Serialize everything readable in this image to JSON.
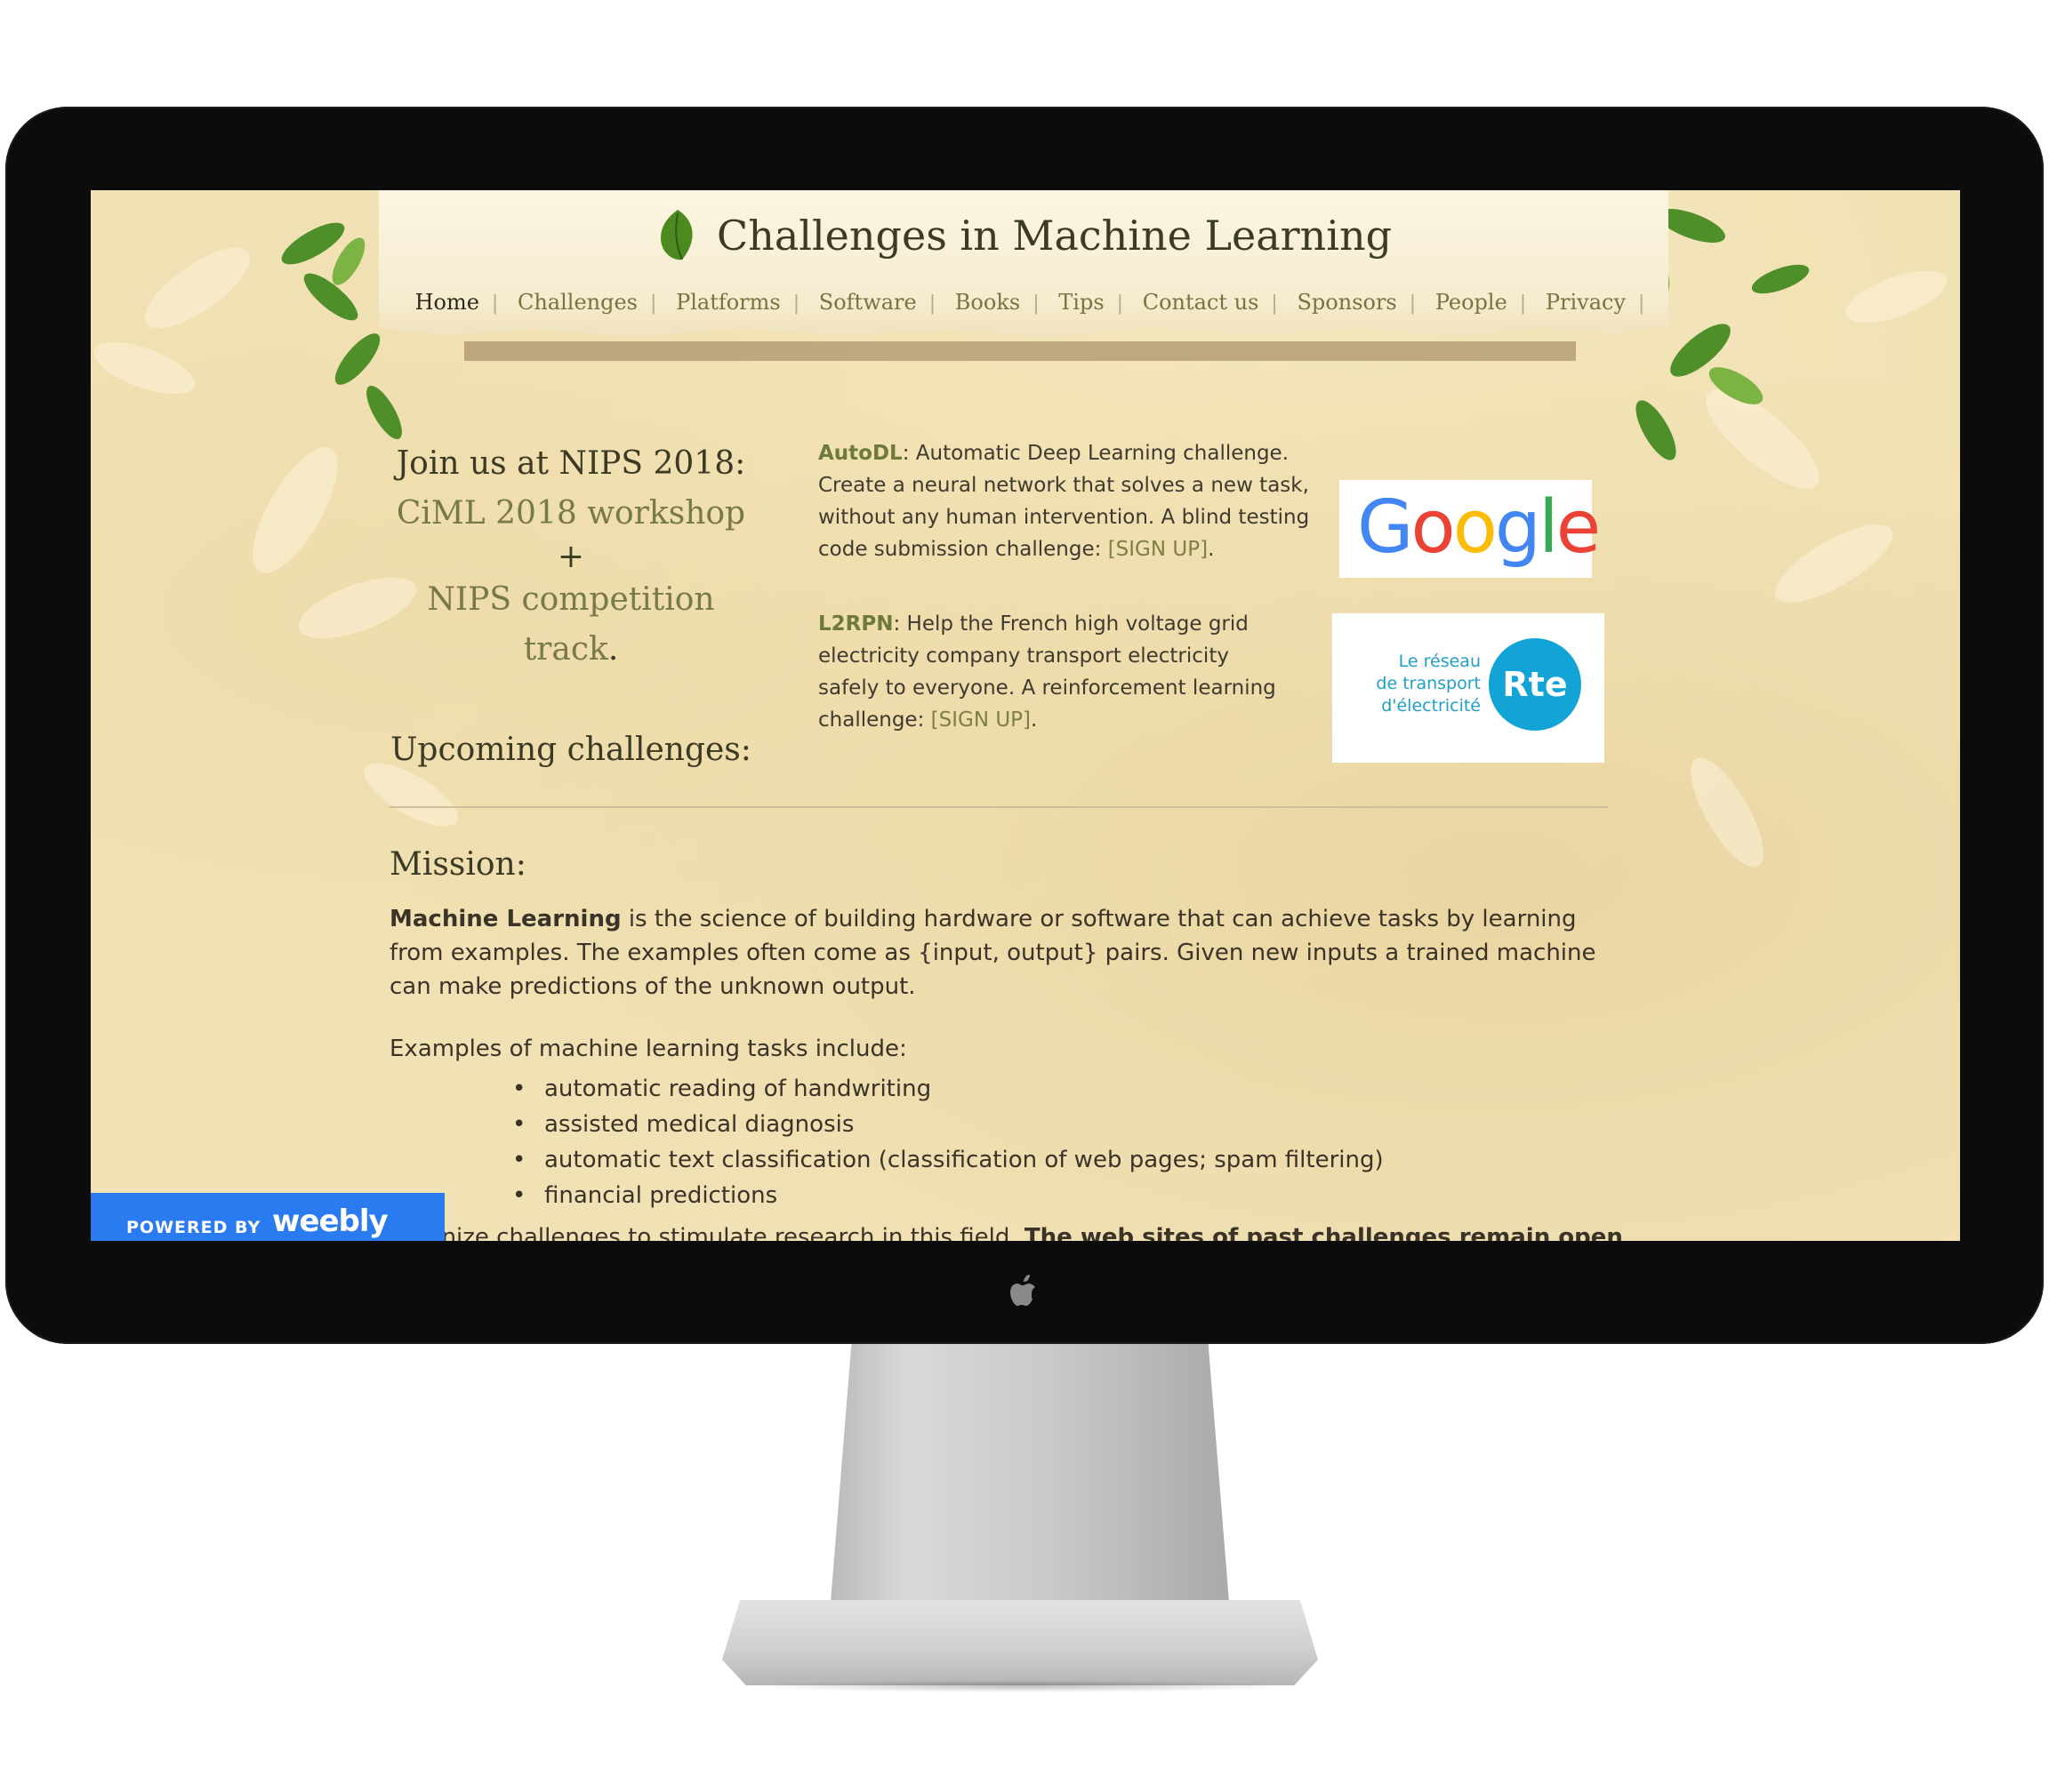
{
  "site": {
    "title": "Challenges in Machine Learning"
  },
  "nav": [
    {
      "label": "Home"
    },
    {
      "label": "Challenges"
    },
    {
      "label": "Platforms"
    },
    {
      "label": "Software"
    },
    {
      "label": "Books"
    },
    {
      "label": "Tips"
    },
    {
      "label": "Contact us"
    },
    {
      "label": "Sponsors"
    },
    {
      "label": "People"
    },
    {
      "label": "Privacy"
    }
  ],
  "nav_separator": "|",
  "intro": {
    "join_text": "Join us at NIPS 2018:",
    "workshop_link": "CiML 2018 workshop",
    "plus": " +",
    "competition_link": "NIPS competition track",
    "period": ".",
    "upcoming": "Upcoming challenges:"
  },
  "challenges": [
    {
      "name": "AutoDL",
      "name_suffix": ":",
      "desc": " Automatic Deep Learning challenge. Create a neural network that solves a new task, without any human intervention. A blind testing code submission challenge: ",
      "signup": "[SIGN UP]",
      "end": ".",
      "sponsor_logo": "Google"
    },
    {
      "name": "L2RPN",
      "name_suffix": ":",
      "desc": " Help the French high voltage grid electricity company transport electricity safely to everyone. A reinforcement learning challenge: ",
      "signup": "[SIGN UP]",
      "end": ".",
      "sponsor_logo_text": [
        "Le réseau",
        "de transport",
        "d'électricité"
      ],
      "sponsor_logo_mark": "Rte"
    }
  ],
  "mission": {
    "heading": "Mission:",
    "bold": "Machine Learning",
    "text": " is the science of building hardware or software that can achieve tasks by learning from examples. The examples often come as {input, output} pairs. Given new inputs a trained machine can make predictions of the unknown output.",
    "examples_intro": "Examples of machine learning tasks include:",
    "tasks": [
      "automatic reading of handwriting",
      "assisted medical diagnosis",
      "automatic text classification (classification of web pages; spam filtering)",
      "financial predictions"
    ],
    "organize_partial": "organize challenges to stimulate research in this field. ",
    "organize_bold_partial": "The web sites of past challenges remain open"
  },
  "weebly": {
    "powered_by": "POWERED BY",
    "logo": "weebly"
  },
  "colors": {
    "accent_green": "#77794a",
    "google_blue": "#4285F4",
    "google_red": "#EA4335",
    "google_yellow": "#FBBC05",
    "google_green": "#34A853",
    "rte_blue": "#12a4d6",
    "weebly_blue": "#2b7bf0"
  }
}
